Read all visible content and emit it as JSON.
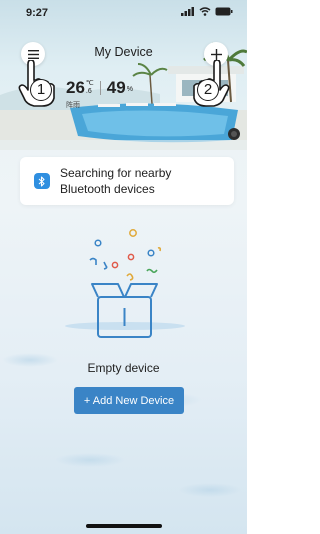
{
  "status_bar": {
    "time": "9:27"
  },
  "header": {
    "title": "My Device"
  },
  "weather": {
    "temperature": "26",
    "temperature_unit": "℃",
    "temperature_decimal": ".6",
    "humidity": "49",
    "humidity_unit": "%",
    "condition": "阵雨"
  },
  "notice": {
    "text": "Searching for nearby Bluetooth devices"
  },
  "empty_state": {
    "label": "Empty device",
    "add_button_label": "+ Add New Device"
  },
  "annotations": {
    "hand_1": "1",
    "hand_2": "2"
  },
  "colors": {
    "primary": "#3a84c6",
    "bluetooth": "#2f8fe0"
  }
}
